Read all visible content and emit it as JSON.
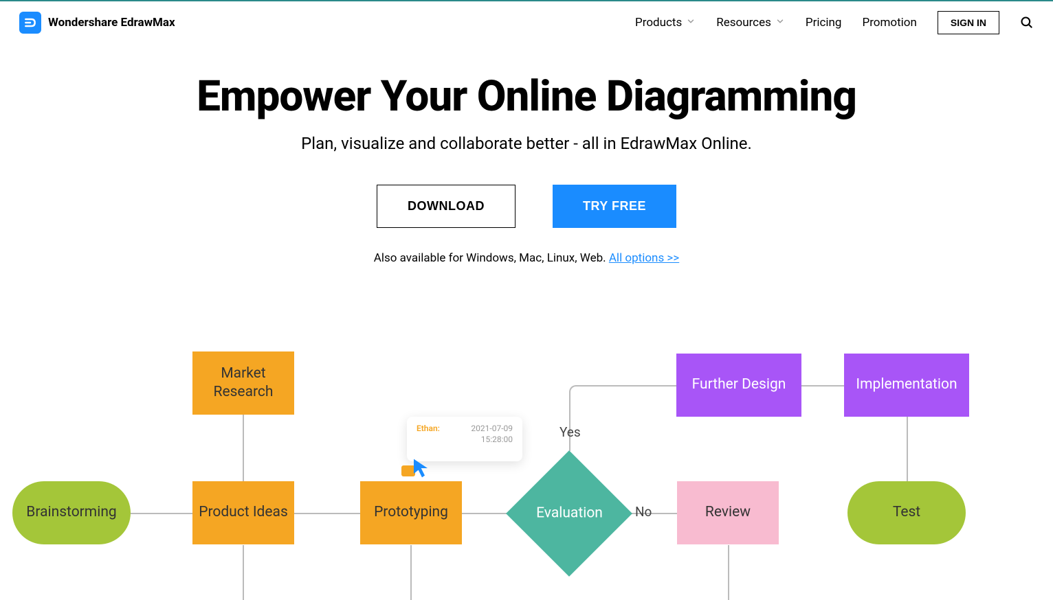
{
  "header": {
    "brand": "Wondershare EdrawMax",
    "nav": {
      "products": "Products",
      "resources": "Resources",
      "pricing": "Pricing",
      "promotion": "Promotion",
      "signin": "SIGN IN"
    }
  },
  "hero": {
    "title": "Empower Your Online Diagramming",
    "subtitle": "Plan, visualize and collaborate better - all in EdrawMax Online.",
    "download_label": "DOWNLOAD",
    "tryfree_label": "TRY FREE",
    "avail_prefix": "Also available for Windows, Mac, Linux, Web. ",
    "avail_link": "All options >>"
  },
  "diagram": {
    "nodes": {
      "brainstorming": "Brainstorming",
      "market_research": "Market\nResearch",
      "product_ideas": "Product Ideas",
      "prototyping": "Prototyping",
      "evaluation": "Evaluation",
      "review": "Review",
      "further_design": "Further Design",
      "implementation": "Implementation",
      "test": "Test"
    },
    "edges": {
      "yes": "Yes",
      "no": "No"
    },
    "comment": {
      "user": "Ethan:",
      "date": "2021-07-09",
      "time": "15:28:00"
    }
  }
}
